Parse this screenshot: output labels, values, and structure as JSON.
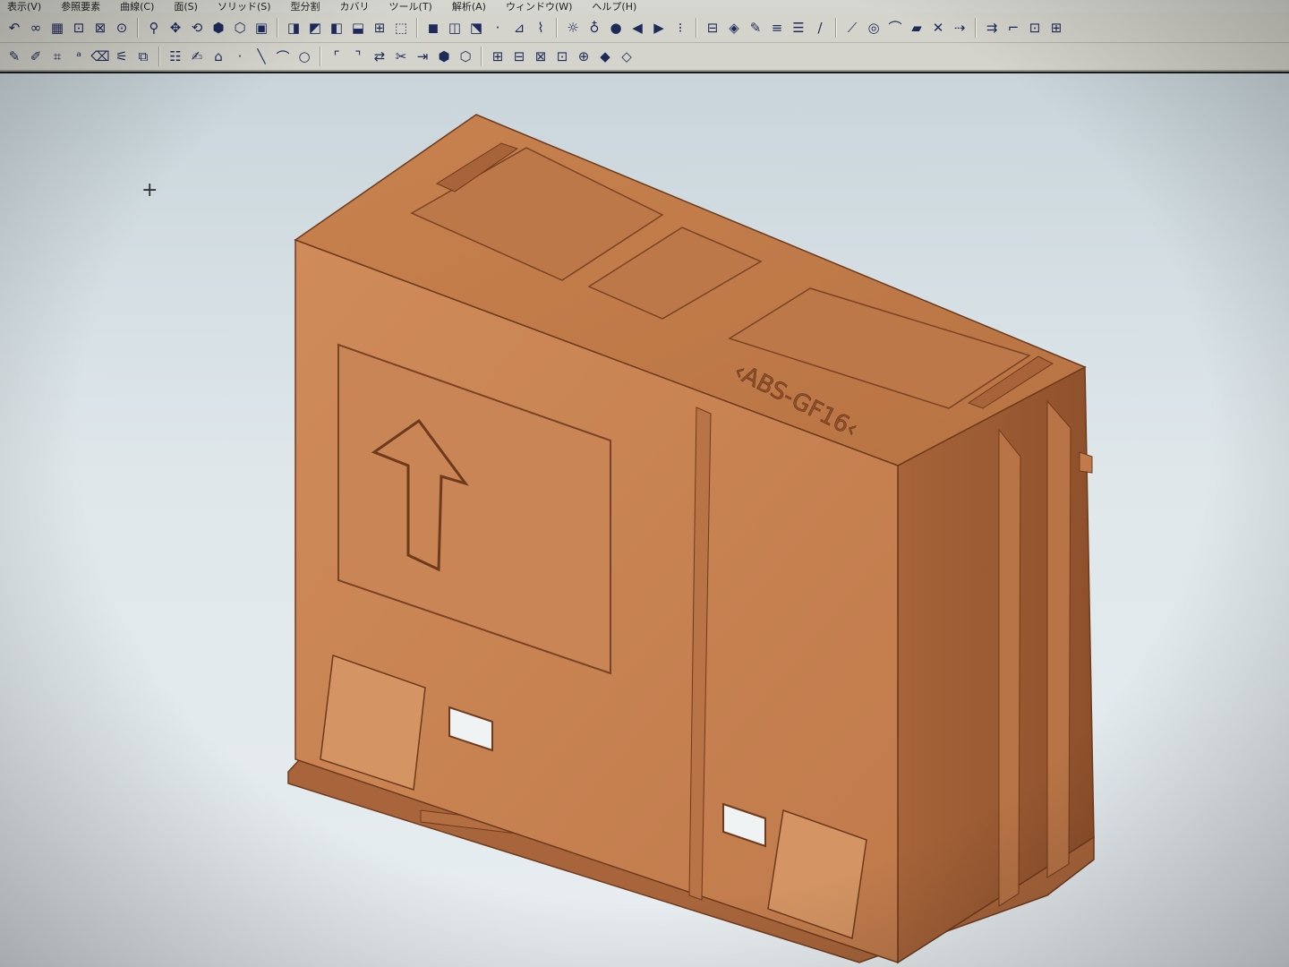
{
  "menu": {
    "items": [
      "表示(V)",
      "参照要素",
      "曲線(C)",
      "面(S)",
      "ソリッド(S)",
      "型分割",
      "カバリ",
      "ツール(T)",
      "解析(A)",
      "ウィンドウ(W)",
      "ヘルプ(H)"
    ]
  },
  "toolbar1": {
    "icons": [
      "undo-icon",
      "layers-icon",
      "grid-icon",
      "zoom-window-icon",
      "zoom-fit-icon",
      "zoom-area-icon",
      "magnify-icon",
      "pan-icon",
      "rotate-icon",
      "view-iso-icon",
      "view-front-icon",
      "view-top-icon",
      "view-right-icon",
      "view-back-icon",
      "view-left-icon",
      "view-bottom-icon",
      "section-icon",
      "wireframe-icon",
      "shaded-icon",
      "hidden-line-icon",
      "display-mode-icon",
      "point-icon",
      "measure-icon",
      "analysis-icon",
      "light-bulb-icon",
      "light-icon",
      "color-icon",
      "back-icon",
      "forward-icon",
      "select-icon",
      "filter-icon",
      "paint-icon",
      "pen-icon",
      "line-style-icon",
      "line-weight-icon",
      "line-icon",
      "polyline-icon",
      "circle-icon",
      "curve-icon",
      "surface-icon",
      "trim-icon",
      "extend-icon",
      "offset-icon",
      "corner-icon",
      "frame-icon",
      "pattern-icon"
    ],
    "glyphs": [
      "↶",
      "∞",
      "▦",
      "⊡",
      "⊠",
      "⊙",
      "⚲",
      "✥",
      "⟲",
      "⬢",
      "⬡",
      "▣",
      "◨",
      "◩",
      "◧",
      "⬓",
      "⊞",
      "⬚",
      "◼",
      "◫",
      "⬔",
      "·",
      "⊿",
      "⌇",
      "☼",
      "♁",
      "●",
      "◀",
      "▶",
      "⁝",
      "⊟",
      "◈",
      "✎",
      "≡",
      "☰",
      "/",
      "⟋",
      "◎",
      "⌒",
      "▰",
      "✕",
      "⇢",
      "⇉",
      "⌐",
      "⊡",
      "⊞"
    ]
  },
  "toolbar2": {
    "icons": [
      "sketch-icon",
      "sketch-edit-icon",
      "constraint-icon",
      "dimension-icon",
      "eraser-icon",
      "mirror-icon",
      "copy-icon",
      "list-icon",
      "edit-icon",
      "polygon-icon",
      "point-icon",
      "line-icon",
      "arc-icon",
      "circle-icon",
      "fillet-icon",
      "chamfer-icon",
      "offset-icon",
      "trim-icon",
      "extend-icon",
      "solid-icon",
      "shell-icon",
      "pattern-icon",
      "feature-icon",
      "feature-group-icon",
      "tree-icon",
      "tree-add-icon",
      "color-solid-icon",
      "color-surface-icon"
    ],
    "glyphs": [
      "✎",
      "✐",
      "⌗",
      "ᵃ",
      "⌫",
      "⚟",
      "⧉",
      "☷",
      "✍",
      "⌂",
      "·",
      "╲",
      "⌒",
      "○",
      "⌜",
      "⌝",
      "⇄",
      "✂",
      "⇥",
      "⬢",
      "⬡",
      "⊞",
      "⊟",
      "⊠",
      "⊡",
      "⊕",
      "◆",
      "◇"
    ]
  },
  "viewport": {
    "background_top": "#c9d5db",
    "background_bottom": "#e7edf0",
    "cursor_icon": "crosshair-icon"
  },
  "model": {
    "color_front": "#c98556",
    "color_top": "#c17c4f",
    "color_side": "#9e5c33",
    "color_edge": "#6e3a1c",
    "embossed_text": "‹ABS-GF16‹",
    "arrow_icon": "up-arrow-icon"
  }
}
